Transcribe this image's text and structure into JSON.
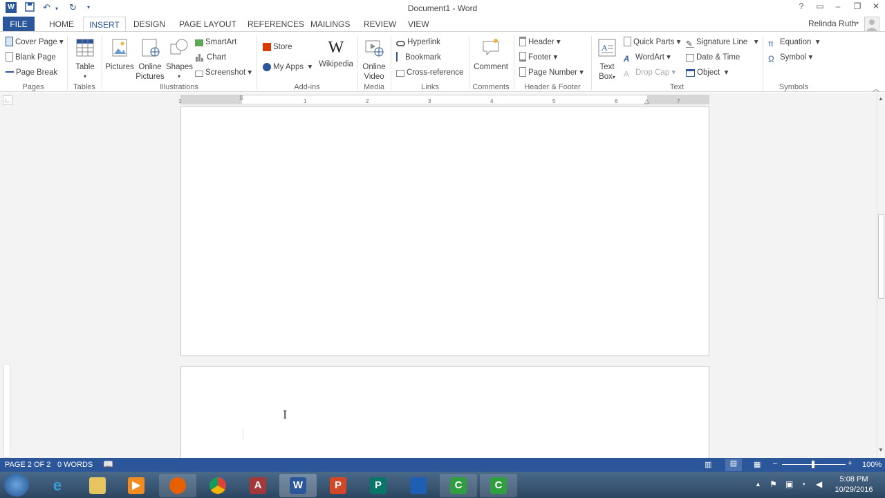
{
  "title": "Document1 - Word",
  "qat": {
    "app_icon": "word-app-icon",
    "save": "save-icon",
    "undo": "undo-icon",
    "redo": "redo-icon",
    "customize": "customize-qat-icon"
  },
  "window": {
    "help": "?",
    "restore_ribbon": "ribbon-display-icon",
    "minimize": "–",
    "maximize": "❐",
    "close": "✕"
  },
  "tabs": [
    "FILE",
    "HOME",
    "INSERT",
    "DESIGN",
    "PAGE LAYOUT",
    "REFERENCES",
    "MAILINGS",
    "REVIEW",
    "VIEW"
  ],
  "active_tab": "INSERT",
  "user": "Relinda Ruth",
  "ribbon": {
    "pages": {
      "label": "Pages",
      "items": [
        "Cover Page",
        "Blank Page",
        "Page Break"
      ]
    },
    "tables": {
      "label": "Tables",
      "table": "Table"
    },
    "illustrations": {
      "label": "Illustrations",
      "pictures": "Pictures",
      "online1": "Online",
      "online2": "Pictures",
      "shapes": "Shapes",
      "smartart": "SmartArt",
      "chart": "Chart",
      "screenshot": "Screenshot"
    },
    "addins": {
      "label": "Add-ins",
      "store": "Store",
      "myapps": "My Apps",
      "wikipedia": "Wikipedia"
    },
    "media": {
      "label": "Media",
      "online": "Online",
      "video": "Video"
    },
    "links": {
      "label": "Links",
      "hyperlink": "Hyperlink",
      "bookmark": "Bookmark",
      "crossref": "Cross-reference"
    },
    "comments": {
      "label": "Comments",
      "comment": "Comment"
    },
    "headerfooter": {
      "label": "Header & Footer",
      "header": "Header",
      "footer": "Footer",
      "pagenumber": "Page Number"
    },
    "text": {
      "label": "Text",
      "textbox1": "Text",
      "textbox2": "Box",
      "quickparts": "Quick Parts",
      "wordart": "WordArt",
      "dropcap": "Drop Cap",
      "signature": "Signature Line",
      "datetime": "Date & Time",
      "object": "Object"
    },
    "symbols": {
      "label": "Symbols",
      "equation": "Equation",
      "symbol": "Symbol"
    }
  },
  "ruler": {
    "ticks": [
      "1",
      "1",
      "2",
      "3",
      "4",
      "5",
      "6",
      "7"
    ]
  },
  "status": {
    "page": "PAGE 2 OF 2",
    "words": "0 WORDS",
    "zoom": "100%"
  },
  "clock": {
    "time": "5:08 PM",
    "date": "10/29/2016"
  },
  "taskbar": {
    "colors": {
      "bar": "#3a5878",
      "word": "#2b579a",
      "ppt": "#d24726",
      "access": "#a4373a",
      "publisher": "#077568",
      "camtasia": "#2f9e3f"
    }
  }
}
